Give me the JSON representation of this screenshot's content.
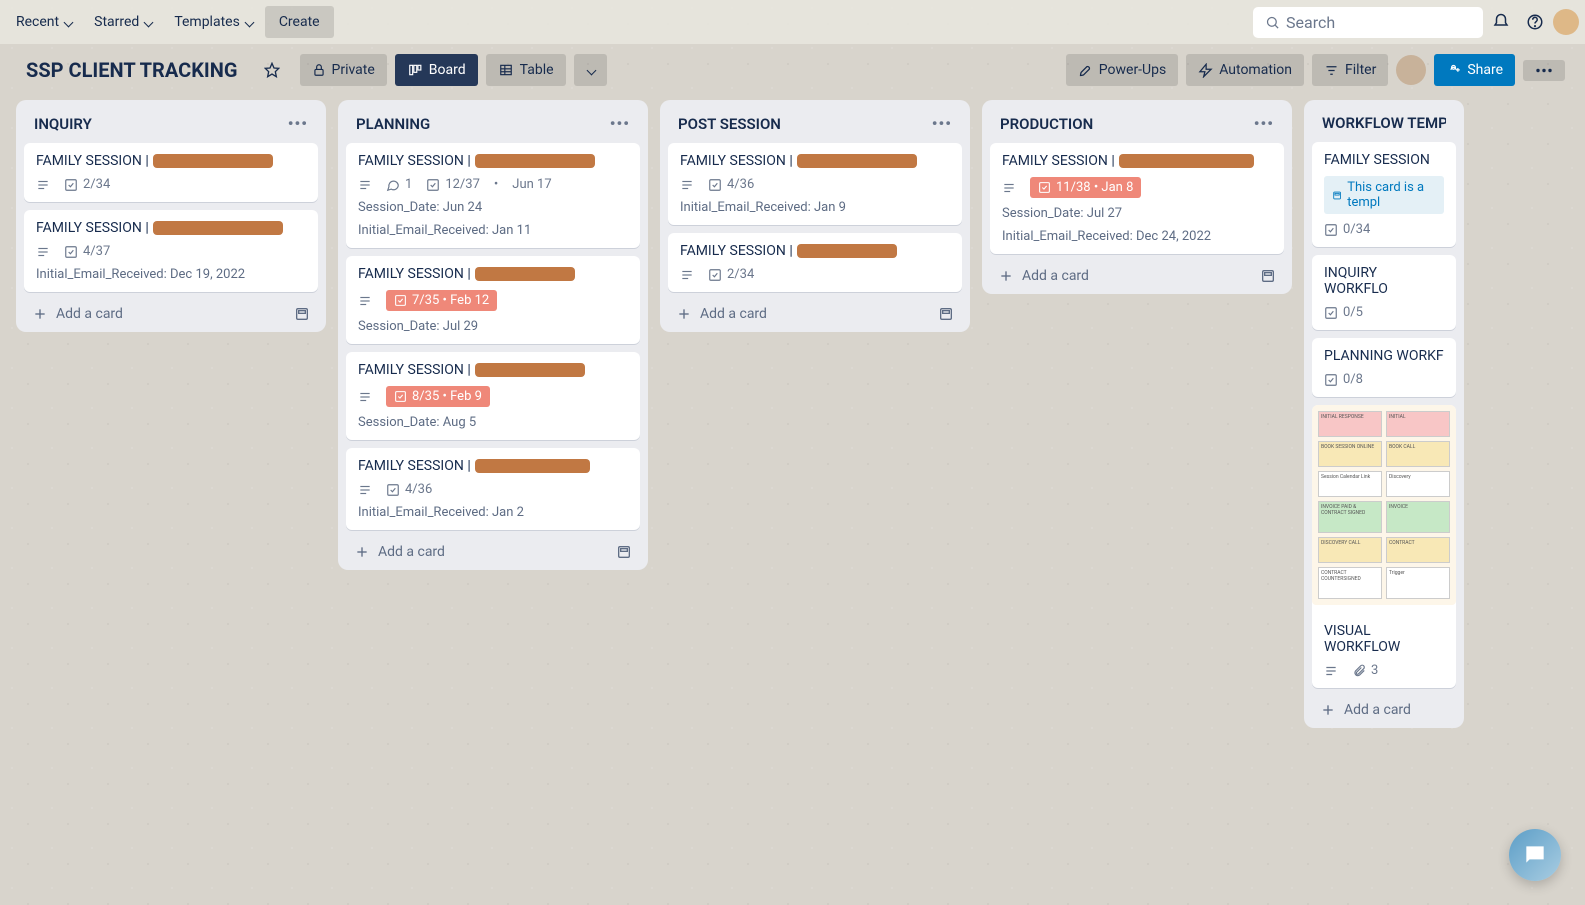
{
  "nav": {
    "recent": "Recent",
    "starred": "Starred",
    "templates": "Templates",
    "create": "Create",
    "search_placeholder": "Search"
  },
  "header": {
    "title": "SSP CLIENT TRACKING",
    "private": "Private",
    "board": "Board",
    "table": "Table",
    "powerups": "Power-Ups",
    "automation": "Automation",
    "filter": "Filter",
    "share": "Share"
  },
  "common": {
    "add_card": "Add a card",
    "card_prefix": "FAMILY SESSION | "
  },
  "lists": {
    "inquiry": {
      "title": "INQUIRY",
      "c1_check": "2/34",
      "c2_check": "4/37",
      "c2_meta": "Initial_Email_Received: Dec 19, 2022"
    },
    "planning": {
      "title": "PLANNING",
      "c1_comments": "1",
      "c1_check": "12/37",
      "c1_date": "Jun 17",
      "c1_m1": "Session_Date: Jun 24",
      "c1_m2": "Initial_Email_Received: Jan 11",
      "c2_chip": "7/35 • Feb 12",
      "c2_m1": "Session_Date: Jul 29",
      "c3_chip": "8/35 • Feb 9",
      "c3_m1": "Session_Date: Aug 5",
      "c4_check": "4/36",
      "c4_m1": "Initial_Email_Received: Jan 2"
    },
    "post": {
      "title": "POST SESSION",
      "c1_check": "4/36",
      "c1_m1": "Initial_Email_Received: Jan 9",
      "c2_check": "2/34"
    },
    "production": {
      "title": "PRODUCTION",
      "c1_chip": "11/38 • Jan 8",
      "c1_m1": "Session_Date: Jul 27",
      "c1_m2": "Initial_Email_Received: Dec 24, 2022"
    },
    "workflow": {
      "title": "WORKFLOW TEMPL",
      "c1_title": "FAMILY SESSION",
      "c1_template": "This card is a templ",
      "c1_check": "0/34",
      "c2_title": "INQUIRY WORKFLO",
      "c2_check": "0/5",
      "c3_title": "PLANNING WORKF",
      "c3_check": "0/8",
      "c4_title": "VISUAL WORKFLOW",
      "c4_attach": "3"
    }
  }
}
